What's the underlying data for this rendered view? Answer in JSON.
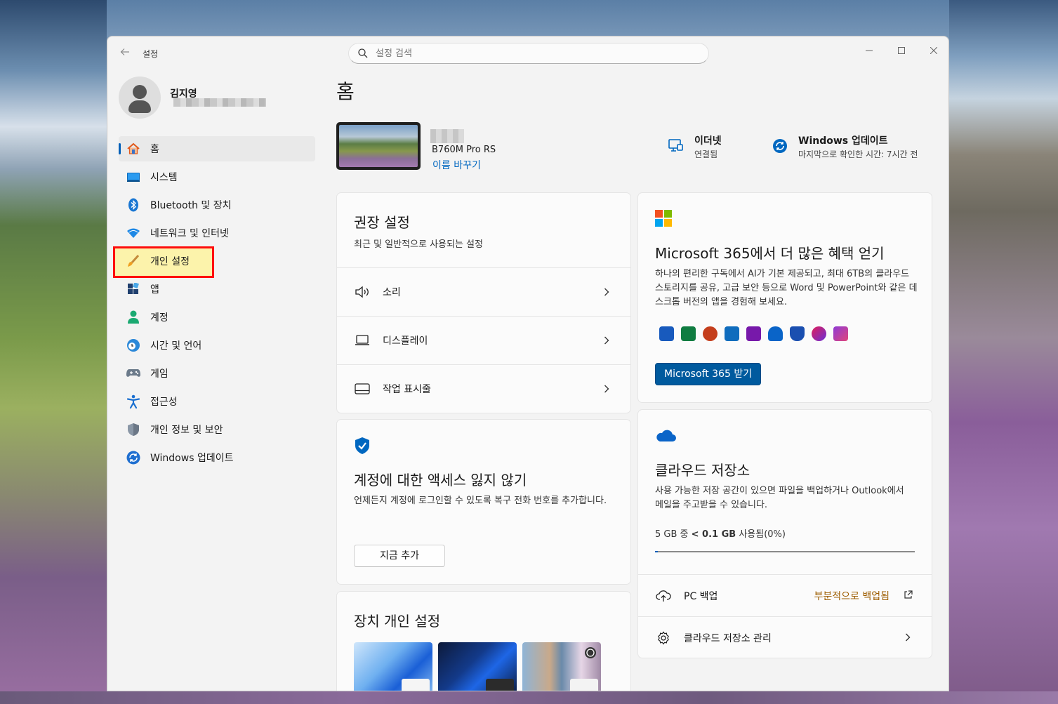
{
  "window": {
    "title": "설정"
  },
  "search": {
    "placeholder": "설정 검색"
  },
  "user": {
    "name": "김지영"
  },
  "sidebar": {
    "items": [
      {
        "label": "홈",
        "icon": "home-icon"
      },
      {
        "label": "시스템",
        "icon": "system-icon"
      },
      {
        "label": "Bluetooth 및 장치",
        "icon": "bluetooth-icon"
      },
      {
        "label": "네트워크 및 인터넷",
        "icon": "wifi-icon"
      },
      {
        "label": "개인 설정",
        "icon": "brush-icon"
      },
      {
        "label": "앱",
        "icon": "apps-icon"
      },
      {
        "label": "계정",
        "icon": "account-icon"
      },
      {
        "label": "시간 및 언어",
        "icon": "clock-globe-icon"
      },
      {
        "label": "게임",
        "icon": "gamepad-icon"
      },
      {
        "label": "접근성",
        "icon": "accessibility-icon"
      },
      {
        "label": "개인 정보 및 보안",
        "icon": "shield-icon"
      },
      {
        "label": "Windows 업데이트",
        "icon": "update-icon"
      }
    ]
  },
  "page": {
    "title": "홈"
  },
  "device": {
    "model": "B760M Pro RS",
    "rename": "이름 바꾸기"
  },
  "status": {
    "network": {
      "title": "이더넷",
      "sub": "연결됨"
    },
    "update": {
      "title": "Windows 업데이트",
      "sub": "마지막으로 확인한 시간: 7시간 전"
    }
  },
  "recommended": {
    "title": "권장 설정",
    "subtitle": "최근 및 일반적으로 사용되는 설정",
    "rows": [
      {
        "label": "소리",
        "icon": "speaker-icon"
      },
      {
        "label": "디스플레이",
        "icon": "laptop-icon"
      },
      {
        "label": "작업 표시줄",
        "icon": "taskbar-icon"
      }
    ]
  },
  "account_access": {
    "title": "계정에 대한 액세스 잃지 않기",
    "body": "언제든지 계정에 로그인할 수 있도록 복구 전화 번호를 추가합니다.",
    "button": "지금 추가"
  },
  "personalize": {
    "title": "장치 개인 설정"
  },
  "m365": {
    "title": "Microsoft 365에서 더 많은 혜택 얻기",
    "body": "하나의 편리한 구독에서 AI가 기본 제공되고, 최대 6TB의 클라우드 스토리지를 공유, 고급 보안 등으로 Word 및 PowerPoint와 같은 데스크톱 버전의 앱을 경험해 보세요.",
    "button": "Microsoft 365 받기",
    "apps": [
      "word",
      "excel",
      "powerpoint",
      "outlook",
      "onenote",
      "onedrive",
      "defender",
      "clipchamp",
      "designer"
    ]
  },
  "cloud": {
    "title": "클라우드 저장소",
    "body": "사용 가능한 저장 공간이 있으면 파일을 백업하거나 Outlook에서 메일을 주고받을 수 있습니다.",
    "usage_prefix": "5 GB 중 ",
    "usage_value": "< 0.1 GB",
    "usage_suffix": " 사용됨(0%)",
    "usage_fraction": 0.0,
    "backup": {
      "label": "PC 백업",
      "status": "부분적으로 백업됨"
    },
    "manage": {
      "label": "클라우드 저장소 관리"
    }
  },
  "colors": {
    "accent": "#005fb8",
    "warning_text": "#9d5d00",
    "highlight_border": "#ff0000"
  }
}
